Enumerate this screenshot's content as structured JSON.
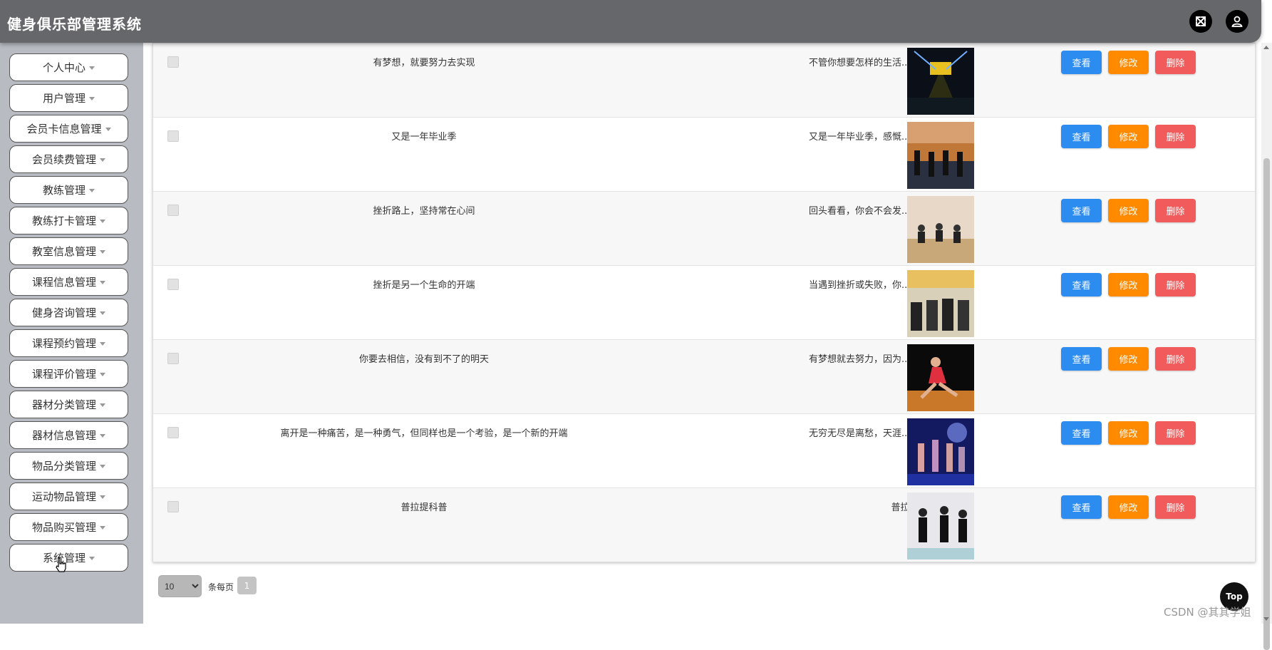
{
  "header": {
    "title": "健身俱乐部管理系统",
    "fullscreen_icon": "fullscreen-icon",
    "user_icon": "user-icon"
  },
  "sidebar": {
    "items": [
      {
        "label": "个人中心"
      },
      {
        "label": "用户管理"
      },
      {
        "label": "会员卡信息管理"
      },
      {
        "label": "会员续费管理"
      },
      {
        "label": "教练管理"
      },
      {
        "label": "教练打卡管理"
      },
      {
        "label": "教室信息管理"
      },
      {
        "label": "课程信息管理"
      },
      {
        "label": "健身咨询管理"
      },
      {
        "label": "课程预约管理"
      },
      {
        "label": "课程评价管理"
      },
      {
        "label": "器材分类管理"
      },
      {
        "label": "器材信息管理"
      },
      {
        "label": "物品分类管理"
      },
      {
        "label": "运动物品管理"
      },
      {
        "label": "物品购买管理"
      },
      {
        "label": "系统管理"
      }
    ]
  },
  "table": {
    "actions": {
      "view": "查看",
      "edit": "修改",
      "delete": "删除"
    },
    "rows": [
      {
        "title": "有梦想，就要努力去实现",
        "content": "不管你想要怎样的生活...",
        "image": "stage-lights"
      },
      {
        "title": "又是一年毕业季",
        "content": "又是一年毕业季，感慨...",
        "image": "gym-interior"
      },
      {
        "title": "挫折路上，坚持常在心间",
        "content": "回头看看，你会不会发...",
        "image": "yoga-class"
      },
      {
        "title": "挫折是另一个生命的开端",
        "content": "当遇到挫折或失败，你...",
        "image": "treadmills"
      },
      {
        "title": "你要去相信，没有到不了的明天",
        "content": "有梦想就去努力，因为...",
        "image": "dancer"
      },
      {
        "title": "离开是一种痛苦，是一种勇气，但同样也是一个考验，是一个新的开端",
        "content": "无穷无尽是离愁，天涯...",
        "image": "dance-stage"
      },
      {
        "title": "普拉提科普",
        "content": "普拉提",
        "image": "pilates"
      }
    ]
  },
  "pagination": {
    "page_size": "10",
    "page_size_options": [
      "10"
    ],
    "per_page_label": "条每页",
    "current_page": "1"
  },
  "top_button": "Top",
  "watermark": "CSDN @其其学姐",
  "colors": {
    "header_bg": "#66676b",
    "sidebar_bg": "#b8bcc2",
    "view_btn": "#2d8cf0",
    "edit_btn": "#ff8a00",
    "delete_btn": "#f25b5b"
  }
}
